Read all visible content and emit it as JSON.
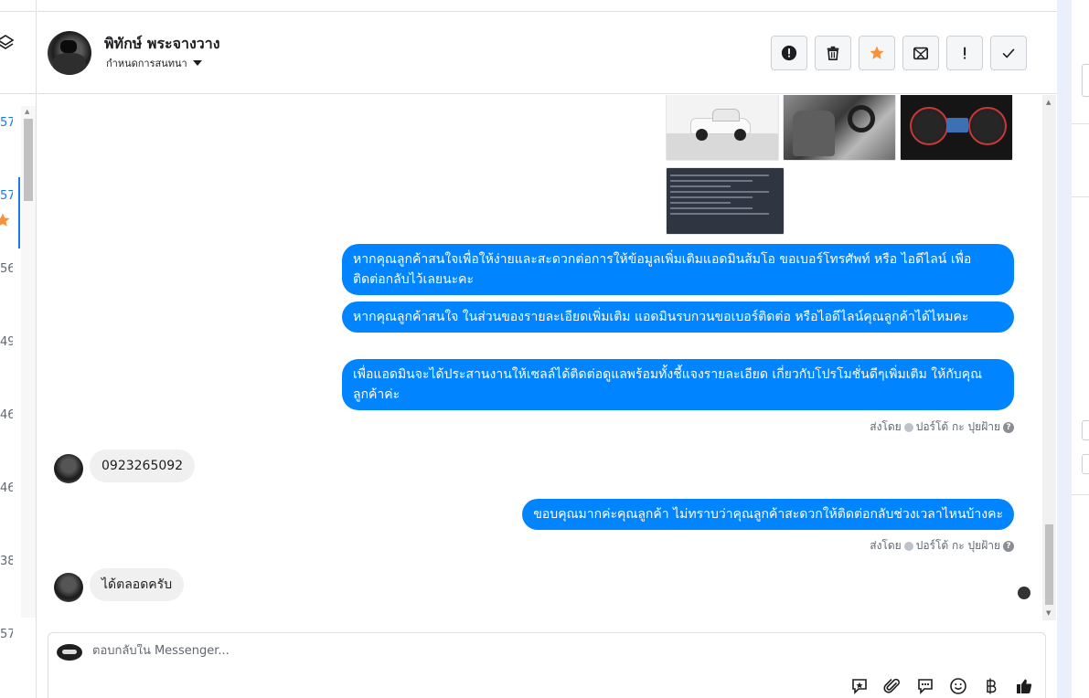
{
  "left_list": {
    "numbers": [
      "57",
      "57",
      "56",
      "49",
      "46",
      "46",
      "38",
      "57"
    ]
  },
  "header": {
    "contact_name": "พิทักษ์ พระจางวาง",
    "assign_label": "กำหนดการสนทนา"
  },
  "actions": [
    {
      "name": "mark-spam-button",
      "icon": "exclamation-circle-icon"
    },
    {
      "name": "delete-button",
      "icon": "trash-icon"
    },
    {
      "name": "star-button",
      "icon": "star-icon"
    },
    {
      "name": "mark-unread-button",
      "icon": "envelope-x-icon"
    },
    {
      "name": "follow-up-button",
      "icon": "exclamation-icon"
    },
    {
      "name": "mark-done-button",
      "icon": "check-icon"
    }
  ],
  "messages": {
    "out_1": "หากคุณลูกค้าสนใจเพื่อให้ง่ายและสะดวกต่อการให้ข้อมูลเพิ่มเติมแอดมินส้มโอ ขอเบอร์โทรศัพท์ หรือ ไอดีไลน์ เพื่อติดต่อกลับไว้เลยนะคะ",
    "out_2": "หากคุณลูกค้าสนใจ ในส่วนของรายละเอียดเพิ่มเติม แอดมินรบกวนขอเบอร์ติดต่อ หรือไอดีไลน์คุณลูกค้าได้ไหมคะ",
    "out_3": "เพื่อแอดมินจะได้ประสานงานให้เซลล์ได้ติดต่อดูแลพร้อมทั้งชี้แจงรายละเอียด เกี่ยวกับโปรโมชั่นดีๆเพิ่มเติม ให้กับคุณลูกค้าค่ะ",
    "sent_by_1": "ส่งโดย",
    "sender_1": "ปอร์โต้ กะ ปุยฝ้าย",
    "in_1": "0923265092",
    "out_4": "ขอบคุณมากค่ะคุณลูกค้า ไม่ทราบว่าคุณลูกค้าสะดวกให้ติดต่อกลับช่วงเวลาไหนบ้างคะ",
    "sent_by_2": "ส่งโดย",
    "sender_2": "ปอร์โต้ กะ ปุยฝ้าย",
    "in_2": "ได้ตลอดครับ"
  },
  "composer": {
    "placeholder": "ตอบกลับใน Messenger...",
    "value": ""
  },
  "composer_tools": [
    "saved-reply-icon",
    "attachment-icon",
    "chat-options-icon",
    "emoji-icon",
    "baht-icon",
    "like-icon"
  ],
  "colors": {
    "accent_blue": "#0084ff",
    "star_orange": "#f7923a",
    "incoming_bubble": "#f0f0f0"
  }
}
